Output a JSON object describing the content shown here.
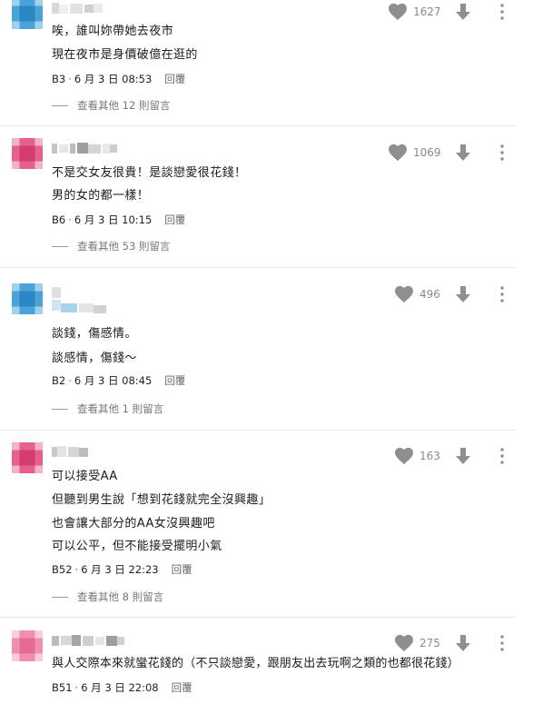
{
  "comments": [
    {
      "lines": [
        "唉，誰叫妳帶她去夜市",
        "現在夜市是身價破億在逛的"
      ],
      "floor": "B3",
      "date": "6 月 3 日 08:53",
      "reply_label": "回覆",
      "likes": "1627",
      "more_replies": "查看其他 12 則留言",
      "avatar_colors": [
        "#4aa3d8",
        "#9fd0ee",
        "#2a86c4"
      ]
    },
    {
      "lines": [
        "不是交女友很貴！是談戀愛很花錢！",
        "男的女的都一樣！"
      ],
      "floor": "B6",
      "date": "6 月 3 日 10:15",
      "reply_label": "回覆",
      "likes": "1069",
      "more_replies": "查看其他 53 則留言",
      "avatar_colors": [
        "#e65f8e",
        "#f3b4c9",
        "#d23c73"
      ]
    },
    {
      "lines": [
        "談錢，傷感情。",
        "談感情，傷錢～"
      ],
      "floor": "B2",
      "date": "6 月 3 日 08:45",
      "reply_label": "回覆",
      "likes": "496",
      "more_replies": "查看其他 1 則留言",
      "avatar_colors": [
        "#4aa3d8",
        "#9fd0ee",
        "#2a86c4"
      ]
    },
    {
      "lines": [
        "可以接受AA",
        "但聽到男生說「想到花錢就完全沒興趣」",
        "也會讓大部分的AA女沒興趣吧",
        "可以公平，但不能接受擺明小氣"
      ],
      "floor": "B52",
      "date": "6 月 3 日 22:23",
      "reply_label": "回覆",
      "likes": "163",
      "more_replies": "查看其他 8 則留言",
      "avatar_colors": [
        "#e65f8e",
        "#f3b4c9",
        "#d23c73"
      ]
    },
    {
      "lines": [
        "與人交際本來就蠻花錢的（不只談戀愛，跟朋友出去玩啊之類的也都很花錢）"
      ],
      "floor": "B51",
      "date": "6 月 3 日 22:08",
      "reply_label": "回覆",
      "likes": "275",
      "more_replies": "",
      "avatar_colors": [
        "#f08db0",
        "#f9cddd",
        "#e66a97"
      ]
    }
  ],
  "icons": {
    "like": "heart-icon",
    "dislike": "arrow-down-icon",
    "more": "more-vertical-icon"
  },
  "colors": {
    "icon_gray": "#8f8f8f",
    "divider": "#e6e6e6"
  }
}
